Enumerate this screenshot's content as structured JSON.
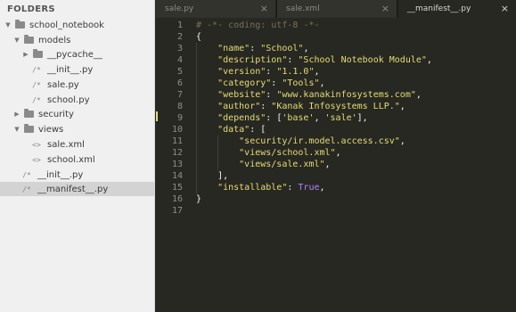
{
  "sidebar": {
    "header": "FOLDERS",
    "rows": [
      {
        "type": "folder",
        "state": "open",
        "label": "school_notebook"
      },
      {
        "type": "folder",
        "state": "open",
        "label": "models"
      },
      {
        "type": "folder",
        "state": "closed",
        "label": "__pycache__"
      },
      {
        "type": "file",
        "icon": "/*",
        "label": "__init__.py"
      },
      {
        "type": "file",
        "icon": "/*",
        "label": "sale.py"
      },
      {
        "type": "file",
        "icon": "/*",
        "label": "school.py"
      },
      {
        "type": "folder",
        "state": "closed",
        "label": "security"
      },
      {
        "type": "folder",
        "state": "open",
        "label": "views"
      },
      {
        "type": "file",
        "icon": "<>",
        "label": "sale.xml"
      },
      {
        "type": "file",
        "icon": "<>",
        "label": "school.xml"
      },
      {
        "type": "file",
        "icon": "/*",
        "label": "__init__.py"
      },
      {
        "type": "file",
        "icon": "/*",
        "label": "__manifest__.py",
        "selected": true
      }
    ]
  },
  "tabs": [
    {
      "label": "sale.py",
      "active": false,
      "close": "×"
    },
    {
      "label": "sale.xml",
      "active": false,
      "close": "×"
    },
    {
      "label": "__manifest__.py",
      "active": true,
      "close": "×"
    }
  ],
  "editor": {
    "lines": [
      {
        "n": "1",
        "tokens": [
          {
            "c": "cmt",
            "t": "# -*- coding: utf-8 -*-"
          }
        ]
      },
      {
        "n": "2",
        "tokens": [
          {
            "c": "pun",
            "t": "{"
          }
        ]
      },
      {
        "n": "3",
        "tokens": [
          {
            "c": "str",
            "t": "    \"name\""
          },
          {
            "c": "pun",
            "t": ": "
          },
          {
            "c": "str",
            "t": "\"School\""
          },
          {
            "c": "pun",
            "t": ","
          }
        ]
      },
      {
        "n": "4",
        "tokens": [
          {
            "c": "str",
            "t": "    \"description\""
          },
          {
            "c": "pun",
            "t": ": "
          },
          {
            "c": "str",
            "t": "\"School Notebook Module\""
          },
          {
            "c": "pun",
            "t": ","
          }
        ]
      },
      {
        "n": "5",
        "tokens": [
          {
            "c": "str",
            "t": "    \"version\""
          },
          {
            "c": "pun",
            "t": ": "
          },
          {
            "c": "str",
            "t": "\"1.1.0\""
          },
          {
            "c": "pun",
            "t": ","
          }
        ]
      },
      {
        "n": "6",
        "tokens": [
          {
            "c": "str",
            "t": "    \"category\""
          },
          {
            "c": "pun",
            "t": ": "
          },
          {
            "c": "str",
            "t": "\"Tools\""
          },
          {
            "c": "pun",
            "t": ","
          }
        ]
      },
      {
        "n": "7",
        "tokens": [
          {
            "c": "str",
            "t": "    \"website\""
          },
          {
            "c": "pun",
            "t": ": "
          },
          {
            "c": "str",
            "t": "\"www.kanakinfosystems.com\""
          },
          {
            "c": "pun",
            "t": ","
          }
        ]
      },
      {
        "n": "8",
        "tokens": [
          {
            "c": "str",
            "t": "    \"author\""
          },
          {
            "c": "pun",
            "t": ": "
          },
          {
            "c": "str",
            "t": "\"Kanak Infosystems LLP.\""
          },
          {
            "c": "pun",
            "t": ","
          }
        ]
      },
      {
        "n": "9",
        "tokens": [
          {
            "c": "str",
            "t": "    \"depends\""
          },
          {
            "c": "pun",
            "t": ": ["
          },
          {
            "c": "str",
            "t": "'base'"
          },
          {
            "c": "pun",
            "t": ", "
          },
          {
            "c": "str",
            "t": "'sale'"
          },
          {
            "c": "pun",
            "t": "],"
          }
        ]
      },
      {
        "n": "10",
        "tokens": [
          {
            "c": "str",
            "t": "    \"data\""
          },
          {
            "c": "pun",
            "t": ": ["
          }
        ]
      },
      {
        "n": "11",
        "tokens": [
          {
            "c": "str",
            "t": "        \"security/ir.model.access.csv\""
          },
          {
            "c": "pun",
            "t": ","
          }
        ]
      },
      {
        "n": "12",
        "tokens": [
          {
            "c": "str",
            "t": "        \"views/school.xml\""
          },
          {
            "c": "pun",
            "t": ","
          }
        ]
      },
      {
        "n": "13",
        "tokens": [
          {
            "c": "str",
            "t": "        \"views/sale.xml\""
          },
          {
            "c": "pun",
            "t": ","
          }
        ]
      },
      {
        "n": "14",
        "tokens": [
          {
            "c": "pun",
            "t": "    ],"
          }
        ]
      },
      {
        "n": "15",
        "tokens": [
          {
            "c": "str",
            "t": "    \"installable\""
          },
          {
            "c": "pun",
            "t": ": "
          },
          {
            "c": "kw",
            "t": "True"
          },
          {
            "c": "pun",
            "t": ","
          }
        ]
      },
      {
        "n": "16",
        "tokens": [
          {
            "c": "pun",
            "t": "}"
          }
        ]
      },
      {
        "n": "17",
        "tokens": []
      }
    ]
  }
}
